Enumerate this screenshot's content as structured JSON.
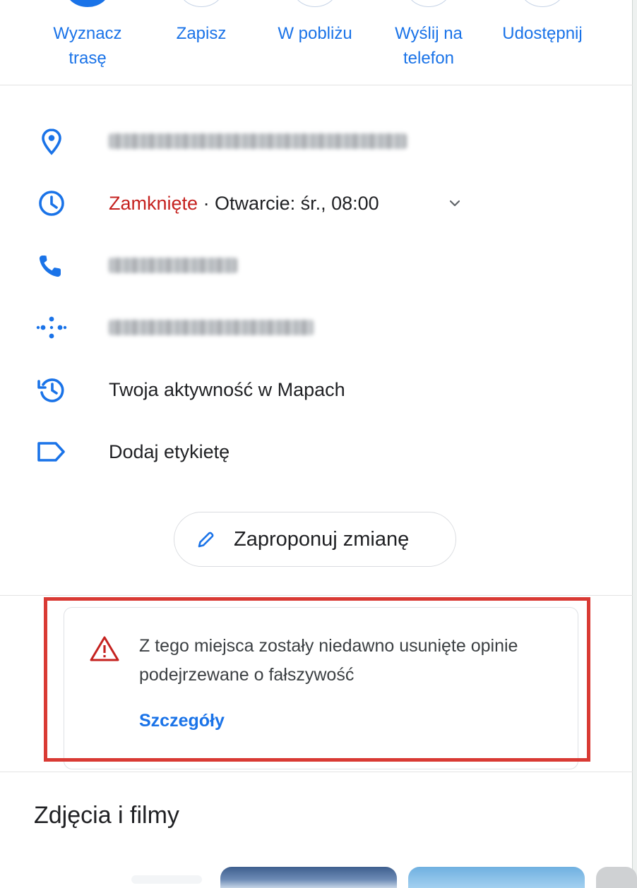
{
  "actions": [
    {
      "label": "Wyznacz trasę",
      "icon": "directions-icon"
    },
    {
      "label": "Zapisz",
      "icon": "bookmark-icon"
    },
    {
      "label": "W pobliżu",
      "icon": "nearby-icon"
    },
    {
      "label": "Wyślij na telefon",
      "icon": "send-to-phone-icon"
    },
    {
      "label": "Udostępnij",
      "icon": "share-icon"
    }
  ],
  "info": {
    "address": {
      "icon": "location-pin-icon"
    },
    "hours": {
      "icon": "clock-icon",
      "status": "Zamknięte",
      "detail": " · Otwarcie: śr., 08:00"
    },
    "phone": {
      "icon": "phone-icon"
    },
    "plus_code": {
      "icon": "plus-code-icon"
    },
    "activity": {
      "icon": "history-icon",
      "label": "Twoja aktywność w Mapach"
    },
    "label": {
      "icon": "label-icon",
      "text": "Dodaj etykietę"
    }
  },
  "suggest_edit": {
    "label": "Zaproponuj zmianę",
    "icon": "pencil-icon"
  },
  "warning": {
    "icon": "warning-triangle-icon",
    "message": "Z tego miejsca zostały niedawno usunięte opinie podejrzewane o fałszywość",
    "link": "Szczegóły"
  },
  "photos": {
    "title": "Zdjęcia i filmy"
  },
  "colors": {
    "accent": "#1a73e8",
    "closed": "#c5221f",
    "highlight": "#d93a34"
  }
}
